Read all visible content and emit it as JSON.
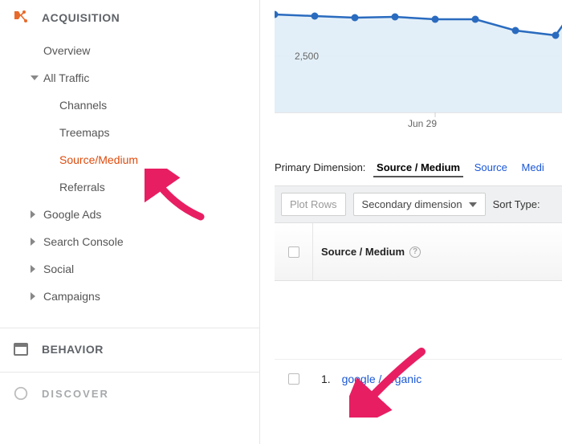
{
  "sidebar": {
    "acquisition": {
      "label": "ACQUISITION",
      "overview": "Overview",
      "all_traffic": {
        "label": "All Traffic",
        "channels": "Channels",
        "treemaps": "Treemaps",
        "source_medium": "Source/Medium",
        "referrals": "Referrals"
      },
      "google_ads": "Google Ads",
      "search_console": "Search Console",
      "social": "Social",
      "campaigns": "Campaigns"
    },
    "behavior": {
      "label": "BEHAVIOR"
    },
    "discover": {
      "label": "DISCOVER"
    }
  },
  "main": {
    "primary_dimension": {
      "label": "Primary Dimension:",
      "active": "Source / Medium",
      "links": [
        "Source",
        "Medi"
      ]
    },
    "toolbar": {
      "plot_rows": "Plot Rows",
      "secondary_dim": "Secondary dimension",
      "sort_type": "Sort Type:"
    },
    "table": {
      "header_col": "Source / Medium",
      "row1": {
        "index": "1.",
        "label": "google / organic"
      }
    }
  },
  "chart_data": {
    "type": "line",
    "x": [
      0,
      1,
      2,
      3,
      4,
      5,
      6,
      7
    ],
    "y": [
      3060,
      3000,
      2950,
      2960,
      2900,
      2900,
      2550,
      2400
    ],
    "xticks": [
      {
        "i": 4,
        "label": "Jun 29"
      }
    ],
    "yticks": [
      {
        "v": 2500,
        "label": "2,500"
      }
    ],
    "ylim": [
      0,
      3500
    ],
    "title": "",
    "xlabel": "",
    "ylabel": ""
  }
}
